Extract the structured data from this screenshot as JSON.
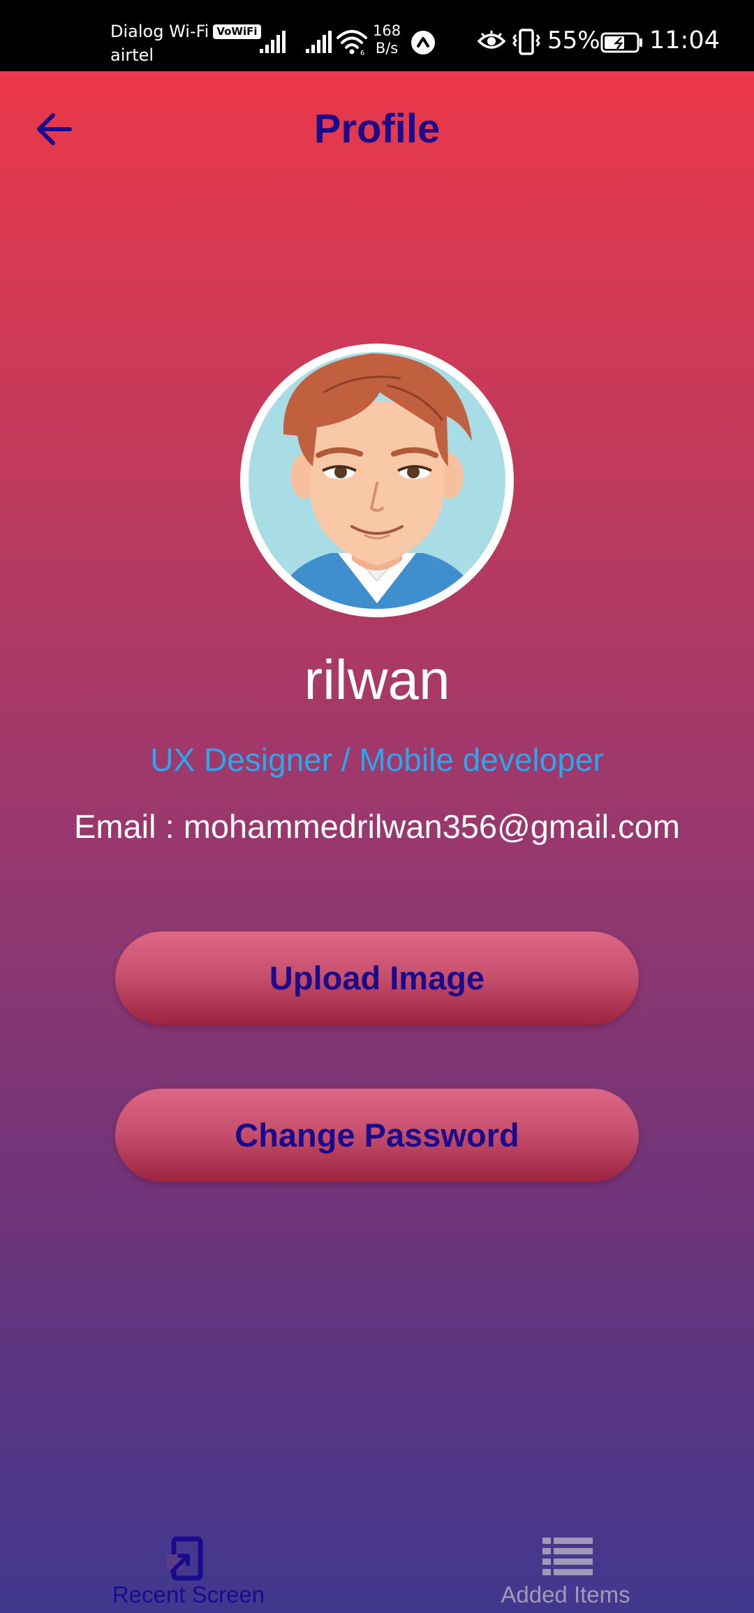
{
  "status_bar": {
    "carrier_line1": "Dialog Wi-Fi",
    "vowifi_badge": "VoWiFi",
    "carrier_line2": "airtel",
    "net_speed_value": "168",
    "net_speed_unit": "B/s",
    "battery_percent": "55%",
    "time": "11:04",
    "icons": [
      "signal-icon",
      "signal-icon",
      "wifi-icon",
      "vpn-icon",
      "eye-icon",
      "vibrate-icon",
      "battery-icon"
    ]
  },
  "header": {
    "back_icon": "arrow-left-icon",
    "title": "Profile"
  },
  "profile": {
    "avatar": "avatar-illustration",
    "name": "rilwan",
    "role": "UX Designer / Mobile developer",
    "email": "Email : mohammedrilwan356@gmail.com"
  },
  "actions": {
    "upload_label": "Upload Image",
    "change_password_label": "Change Password"
  },
  "bottom_nav": {
    "items": [
      {
        "label": "Recent Screen",
        "icon": "recent-screen-icon",
        "active": true
      },
      {
        "label": "Added Items",
        "icon": "list-icon",
        "active": false
      }
    ]
  },
  "colors": {
    "accent": "#1a0a8c",
    "role_text": "#29a8f0",
    "gradient_top": "#f33846",
    "gradient_bottom": "#40388f",
    "button_top": "#de6784",
    "button_bottom": "#9d2440",
    "inactive_nav": "#a09ab8"
  }
}
